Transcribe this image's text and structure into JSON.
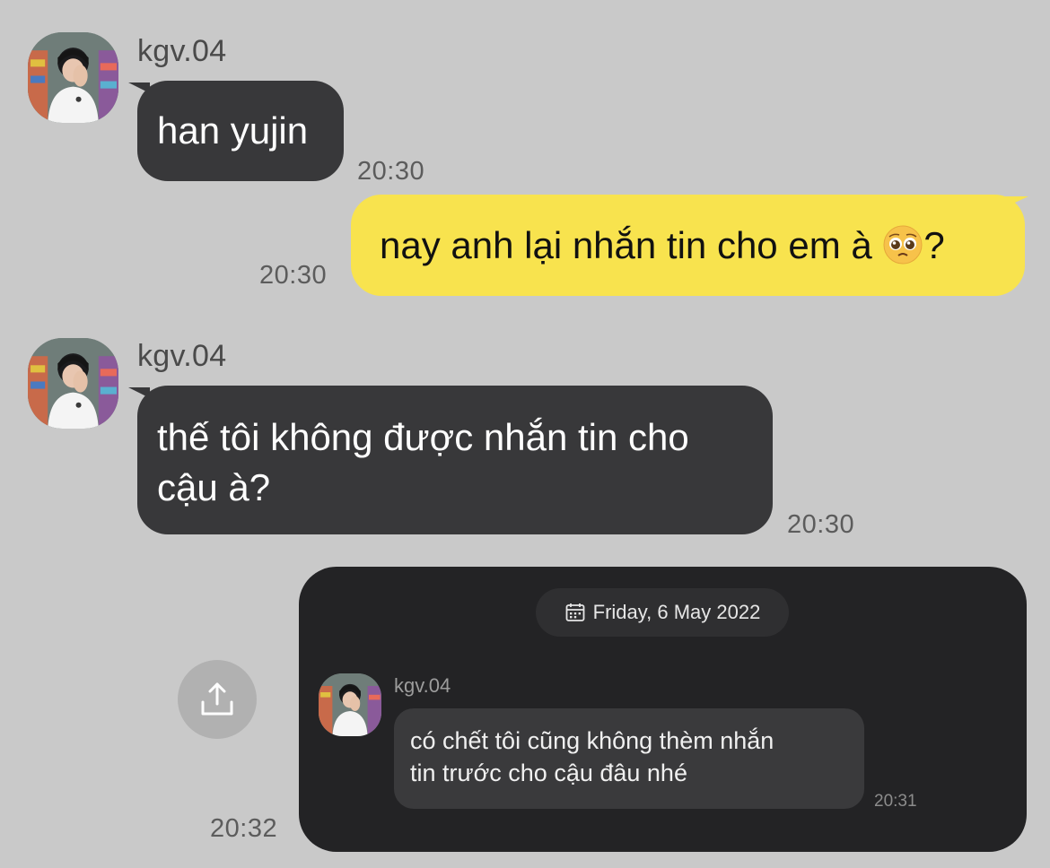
{
  "messages": [
    {
      "sender": "kgv.04",
      "text": "han yujin",
      "time": "20:30"
    },
    {
      "text": "nay anh lại nhắn tin cho em à",
      "suffix": "?",
      "time": "20:30"
    },
    {
      "sender": "kgv.04",
      "line1": "thế tôi không được nhắn tin cho",
      "line2": "cậu à?",
      "time": "20:30"
    }
  ],
  "forwarded": {
    "date": "Friday, 6 May 2022",
    "sender": "kgv.04",
    "line1": "có chết tôi cũng không thèm nhắn",
    "line2": "tin trước cho cậu đâu nhé",
    "time": "20:31",
    "sent_time": "20:32"
  },
  "icons": {
    "share": "share-icon",
    "calendar": "calendar-icon",
    "emoji": "pleading-face-emoji"
  },
  "colors": {
    "background": "#c9c9c9",
    "incoming_bubble": "#38383a",
    "outgoing_bubble": "#f8e34e",
    "card": "#232325"
  }
}
